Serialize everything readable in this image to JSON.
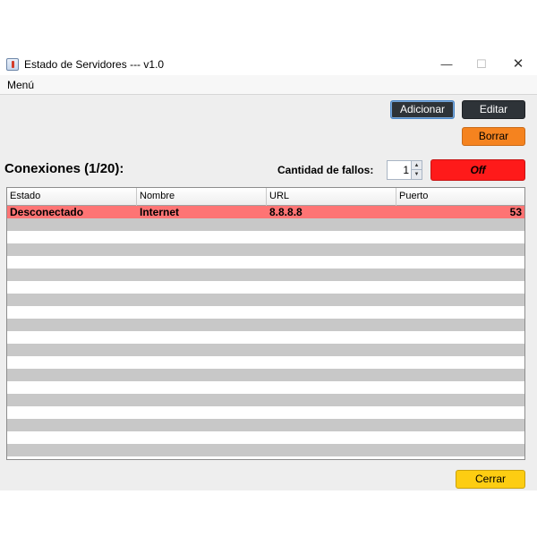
{
  "window": {
    "title": "Estado de Servidores --- v1.0",
    "controls": {
      "minimize": "—",
      "maximize": "☐",
      "close": "✕"
    }
  },
  "menu": {
    "items": [
      "Menú"
    ]
  },
  "toolbar": {
    "add_label": "Adicionar",
    "edit_label": "Editar",
    "delete_label": "Borrar"
  },
  "status": {
    "heading": "Conexiones (1/20):",
    "fail_label": "Cantidad de fallos:",
    "fail_count": "1",
    "toggle_label": "Off",
    "toggle_color": "#fe1a1a"
  },
  "table": {
    "columns": [
      "Estado",
      "Nombre",
      "URL",
      "Puerto"
    ],
    "rows": [
      {
        "estado": "Desconectado",
        "nombre": "Internet",
        "url": "8.8.8.8",
        "puerto": "53",
        "color": "#fe7474"
      }
    ],
    "stripe_color": "#c8c8c8"
  },
  "footer": {
    "close_label": "Cerrar"
  },
  "colors": {
    "add_button": "#2e3338",
    "delete_button": "#f5831f",
    "close_button": "#fdcd12"
  }
}
